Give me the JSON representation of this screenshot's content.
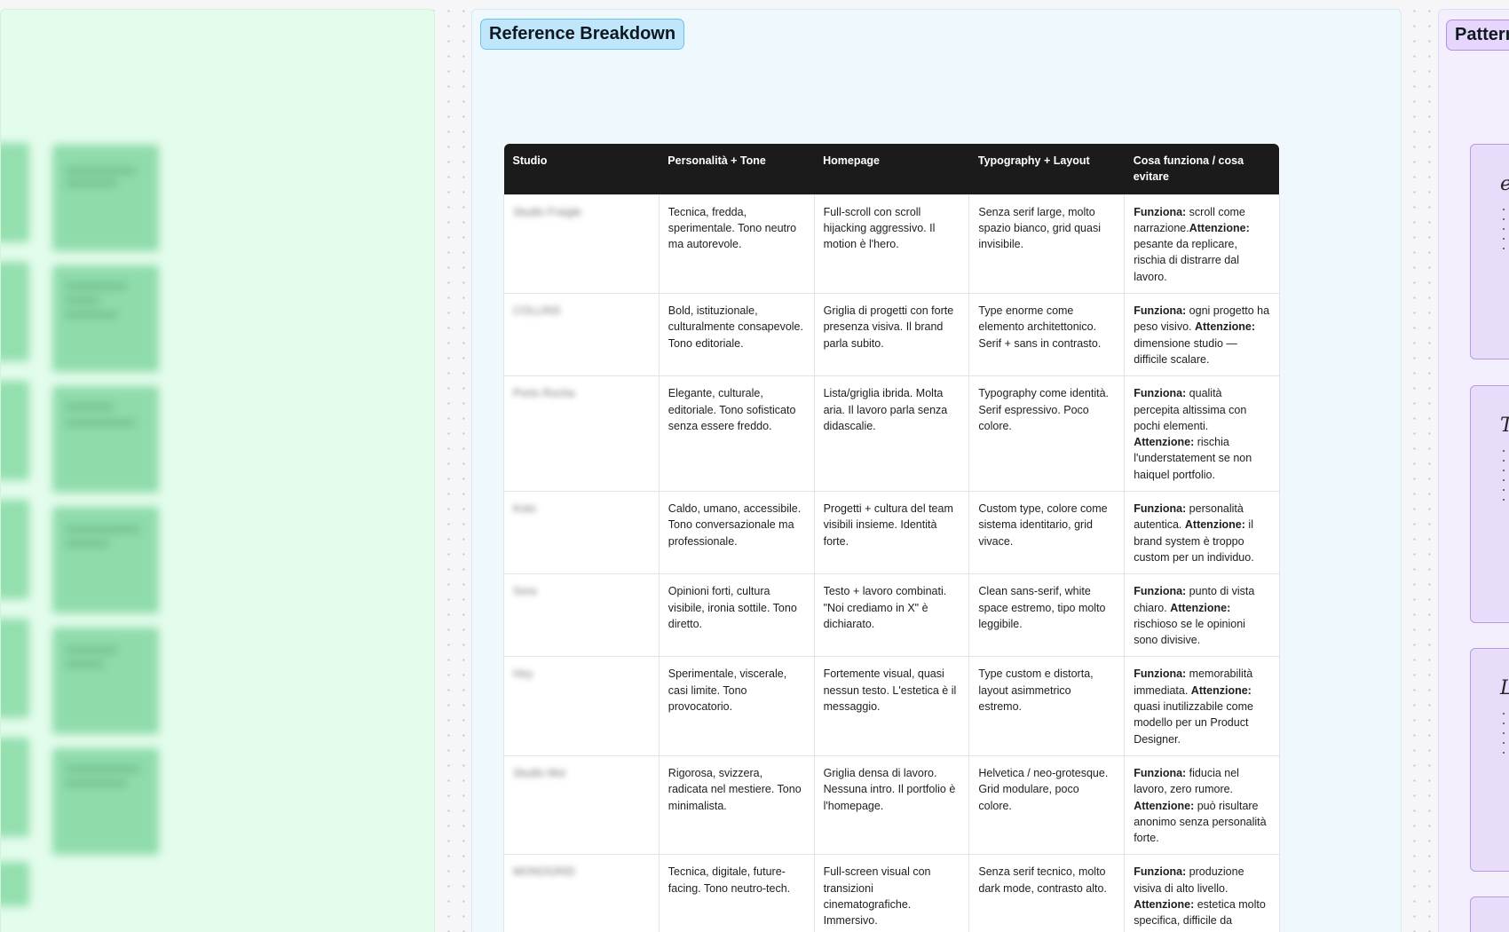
{
  "sections": {
    "middle_label": "Reference Breakdown",
    "right_label": "Pattern"
  },
  "colors": {
    "left_section_bg": "#e3fcec",
    "middle_section_bg": "#eff8fc",
    "right_section_bg": "#f3effc",
    "table_header_bg": "#1b1b1b",
    "blue_label_bg": "#bfe6fb",
    "purple_label_bg": "#e6d6fb"
  },
  "table": {
    "headers": [
      "Studio",
      "Personalità + Tone",
      "Homepage",
      "Typography + Layout",
      "Cosa funziona / cosa evitare"
    ],
    "rows": [
      {
        "studio": "Studio Fraigle",
        "tone": "Tecnica, fredda, sperimentale. Tono neutro ma autorevole.",
        "homepage": "Full-scroll con scroll hijacking aggressivo. Il motion è l'hero.",
        "typography": "Senza serif large, molto spazio bianco, grid quasi invisibile.",
        "works_label": "Funziona:",
        "works": " scroll come narrazione.",
        "avoid_label": "Attenzione:",
        "avoid": " pesante da replicare, rischia di distrarre dal lavoro."
      },
      {
        "studio": "COLLINS",
        "tone": "Bold, istituzionale, culturalmente consapevole. Tono editoriale.",
        "homepage": "Griglia di progetti con forte presenza visiva. Il brand parla subito.",
        "typography": "Type enorme come elemento architettonico. Serif + sans in contrasto.",
        "works_label": "Funziona:",
        "works": " ogni progetto ha peso visivo. ",
        "avoid_label": "Attenzione:",
        "avoid": " dimensione studio — difficile scalare."
      },
      {
        "studio": "Porto Rocha",
        "tone": "Elegante, culturale, editoriale. Tono sofisticato senza essere freddo.",
        "homepage": "Lista/griglia ibrida. Molta aria. Il lavoro parla senza didascalie.",
        "typography": "Typography come identità. Serif espressivo. Poco colore.",
        "works_label": "Funziona:",
        "works": " qualità percepita altissima con pochi elementi. ",
        "avoid_label": "Attenzione:",
        "avoid": " rischia l'understatement se non haiquel portfolio."
      },
      {
        "studio": "Koto",
        "tone": "Caldo, umano, accessibile. Tono conversazionale ma professionale.",
        "homepage": "Progetti + cultura del team visibili insieme. Identità forte.",
        "typography": "Custom type, colore come sistema identitario, grid vivace.",
        "works_label": "Funziona:",
        "works": " personalità autentica. ",
        "avoid_label": "Attenzione:",
        "avoid": " il brand system è troppo custom per un individuo."
      },
      {
        "studio": "Sora",
        "tone": "Opinioni forti, cultura visibile, ironia sottile. Tono diretto.",
        "homepage": "Testo + lavoro combinati. \"Noi crediamo in X\" è dichiarato.",
        "typography": "Clean sans-serif, white space estremo, tipo molto leggibile.",
        "works_label": "Funziona:",
        "works": " punto di vista chiaro. ",
        "avoid_label": "Attenzione:",
        "avoid": " rischioso se le opinioni sono divisive."
      },
      {
        "studio": "Hey",
        "tone": "Sperimentale, viscerale, casi limite. Tono provocatorio.",
        "homepage": "Fortemente visual, quasi nessun testo. L'estetica è il messaggio.",
        "typography": "Type custom e distorta, layout asimmetrico estremo.",
        "works_label": "Funziona:",
        "works": " memorabilità immediata. ",
        "avoid_label": "Attenzione:",
        "avoid": " quasi inutilizzabile come modello per un Product Designer."
      },
      {
        "studio": "Studio Moi",
        "tone": "Rigorosa, svizzera, radicata nel mestiere. Tono minimalista.",
        "homepage": "Griglia densa di lavoro. Nessuna intro. Il portfolio è l'homepage.",
        "typography": "Helvetica / neo-grotesque. Grid modulare, poco colore.",
        "works_label": "Funziona:",
        "works": " fiducia nel lavoro, zero rumore. ",
        "avoid_label": "Attenzione:",
        "avoid": " può risultare anonimo senza personalità forte."
      },
      {
        "studio": "MONOGRID",
        "tone": "Tecnica, digitale, future-facing. Tono neutro-tech.",
        "homepage": "Full-screen visual con transizioni cinematografiche. Immersivo.",
        "typography": "Senza serif tecnico, molto dark mode, contrasto alto.",
        "works_label": "Funziona:",
        "works": " produzione visiva di alto livello. ",
        "avoid_label": "Attenzione:",
        "avoid": " estetica molto specifica, difficile da tradurre fuori dal contesto"
      }
    ]
  },
  "right_cards": [
    {
      "glyph": "e"
    },
    {
      "glyph": "T"
    },
    {
      "glyph": "L"
    }
  ]
}
